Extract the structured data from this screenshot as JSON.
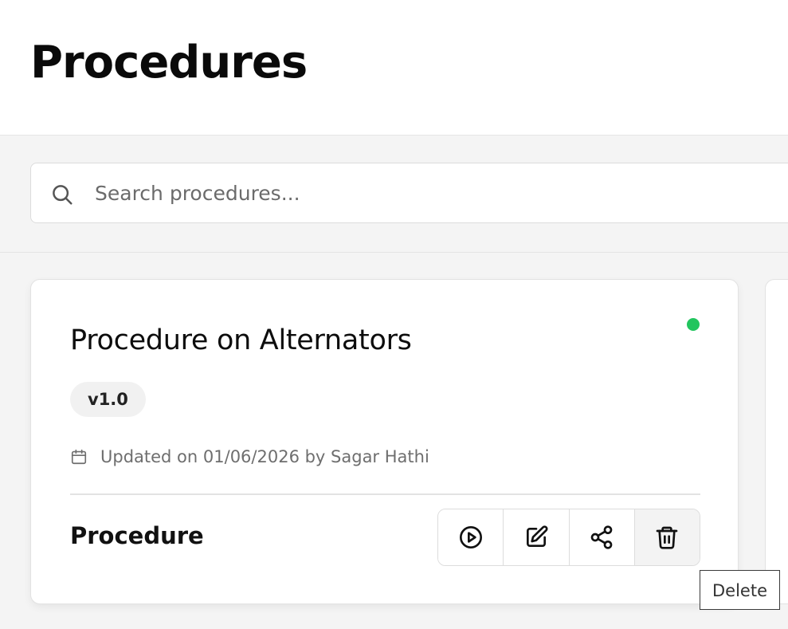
{
  "header": {
    "title": "Procedures"
  },
  "search": {
    "placeholder": "Search procedures...",
    "icon": "search-icon"
  },
  "cards": [
    {
      "title": "Procedure on Alternators",
      "status_color": "#22c55e",
      "version": "v1.0",
      "updated_text": "Updated on 01/06/2026 by Sagar Hathi",
      "type": "Procedure",
      "actions": [
        {
          "name": "run",
          "icon": "play-circle-icon"
        },
        {
          "name": "edit",
          "icon": "edit-icon"
        },
        {
          "name": "share",
          "icon": "share-icon"
        },
        {
          "name": "delete",
          "icon": "trash-icon"
        }
      ]
    }
  ],
  "tooltip": {
    "text": "Delete"
  },
  "colors": {
    "accent_status": "#22c55e",
    "background": "#f4f4f4",
    "card": "#ffffff"
  }
}
